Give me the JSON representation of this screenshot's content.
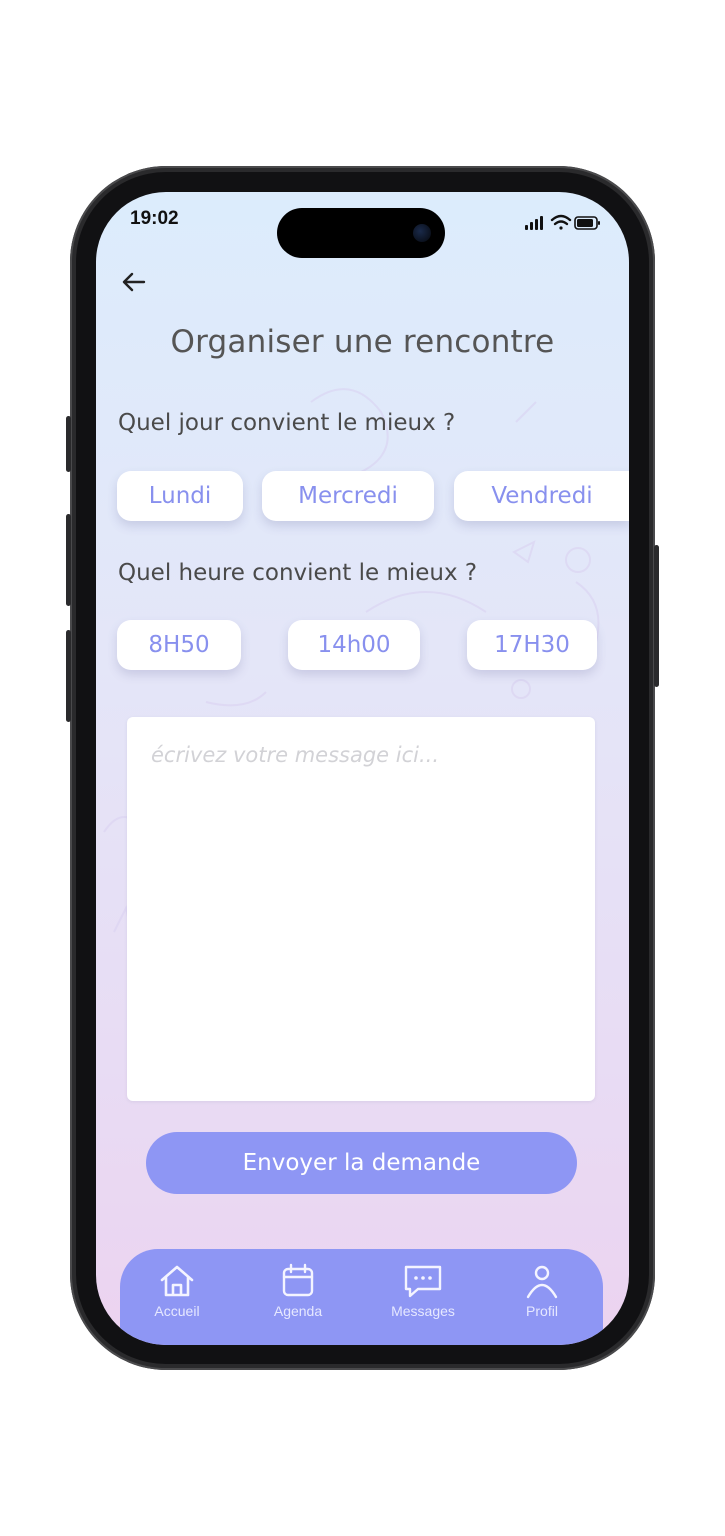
{
  "status_bar": {
    "time": "19:02"
  },
  "header": {
    "title": "Organiser une rencontre"
  },
  "day_section": {
    "question": "Quel jour convient le mieux ?",
    "options": [
      "Lundi",
      "Mercredi",
      "Vendredi"
    ]
  },
  "time_section": {
    "question": "Quel heure convient le mieux ?",
    "options": [
      "8H50",
      "14h00",
      "17H30"
    ]
  },
  "message": {
    "placeholder": "écrivez votre message ici..."
  },
  "send_button": {
    "label": "Envoyer la demande"
  },
  "tab_bar": {
    "items": [
      {
        "label": "Accueil",
        "icon": "home-icon"
      },
      {
        "label": "Agenda",
        "icon": "calendar-icon"
      },
      {
        "label": "Messages",
        "icon": "chat-icon"
      },
      {
        "label": "Profil",
        "icon": "user-icon"
      }
    ]
  },
  "colors": {
    "accent": "#8e96f4",
    "chip_text": "#8890ee",
    "gradient_top": "#dcecfc",
    "gradient_bottom": "#ecd3f0"
  }
}
